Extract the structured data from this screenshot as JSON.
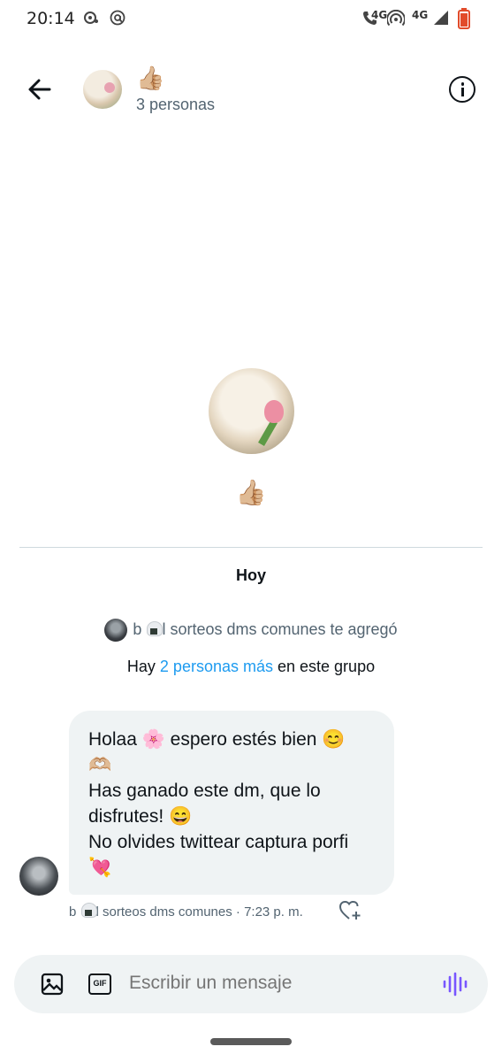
{
  "status_bar": {
    "time": "20:14",
    "network_1": "4G",
    "network_2": "4G",
    "icons": [
      "notification-icon",
      "at-icon",
      "wifi-calling-icon",
      "hotspot-icon",
      "signal-icon",
      "battery-icon"
    ]
  },
  "header": {
    "title_emoji": "👍🏼",
    "subtitle": "3 personas",
    "back_icon": "arrow-left-icon",
    "info_icon": "info-icon"
  },
  "group": {
    "name_emoji": "👍🏼"
  },
  "conversation": {
    "day_label": "Hoy",
    "added_prefix": "b",
    "added_text": "l sorteos dms comunes te agregó",
    "more_prefix": "Hay ",
    "more_link": "2 personas más",
    "more_suffix": " en este grupo"
  },
  "message": {
    "lines": [
      "Holaa 🌸 espero estés bien 😊",
      "🫶🏼",
      "Has ganado este dm, que lo",
      "disfrutes! 😄",
      "No olvides twittear captura porfi",
      "💘"
    ],
    "meta_prefix": "b",
    "meta_text": "l sorteos dms comunes · 7:23 p. m."
  },
  "composer": {
    "placeholder": "Escribir un mensaje",
    "gif_label": "GIF"
  },
  "colors": {
    "accent": "#1d9bf0",
    "bubble": "#eff3f4",
    "muted_text": "#536471",
    "voice": "#7856ff"
  }
}
